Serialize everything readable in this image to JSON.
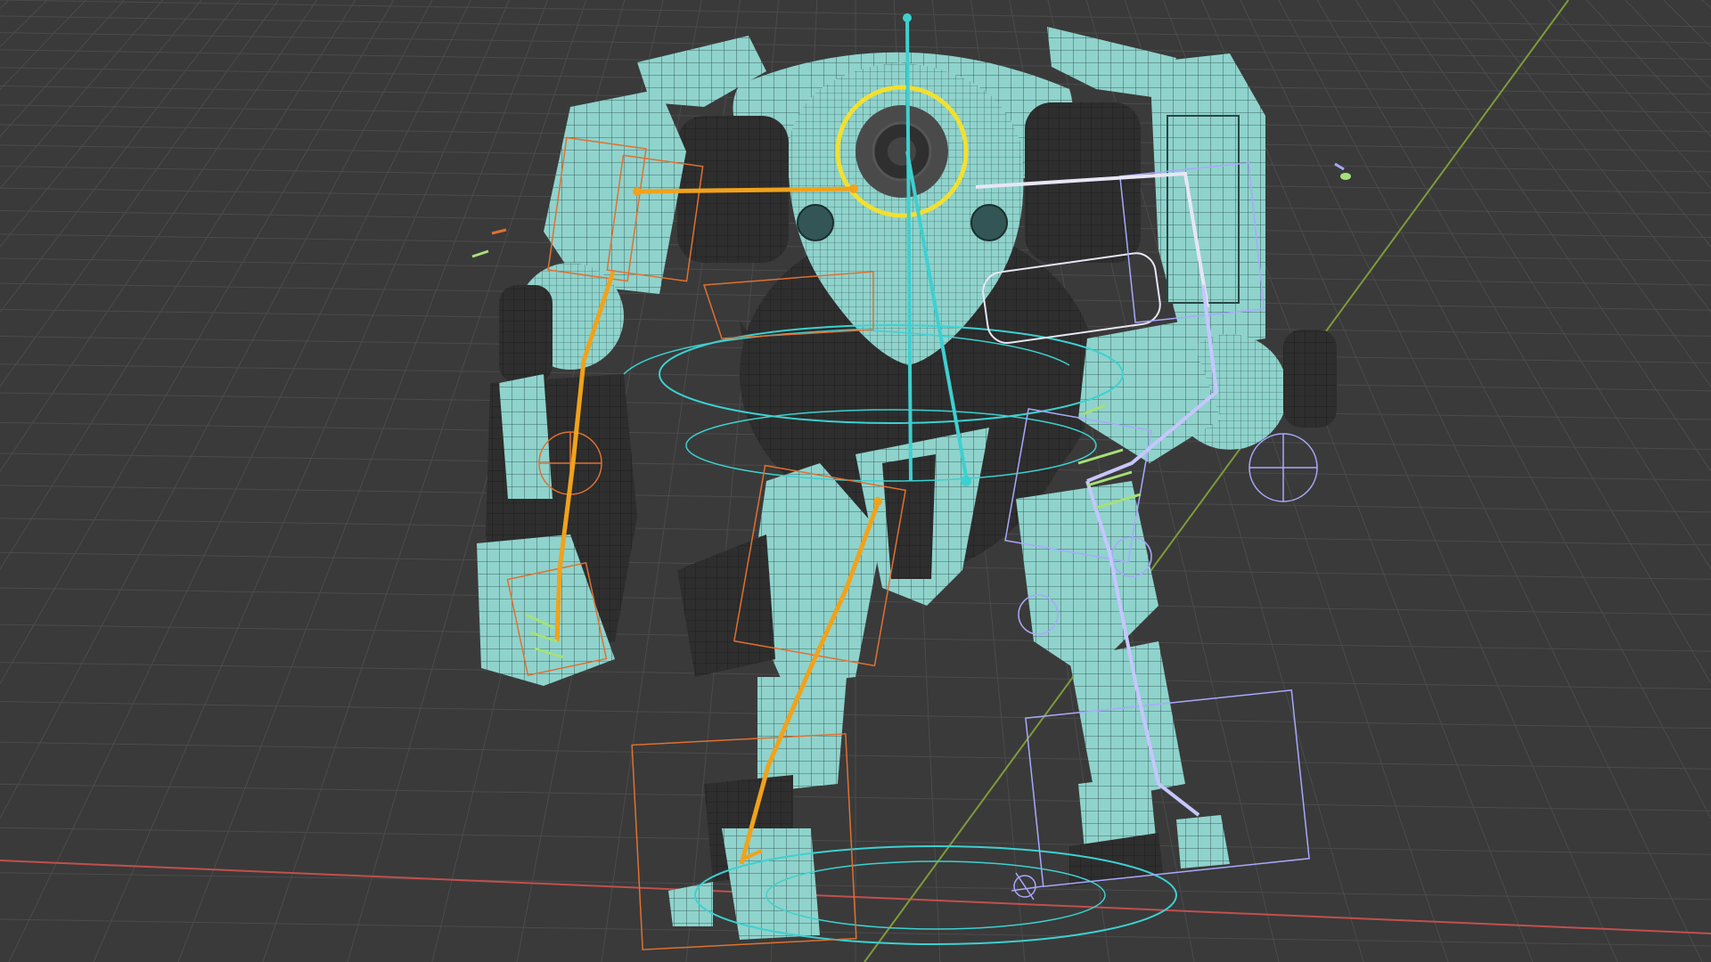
{
  "viewport": {
    "background": "#3a3a3a",
    "grid_color": "#4b4b4b",
    "x_axis_color": "#c0504d",
    "y_axis_color": "#7f9a3a"
  },
  "model": {
    "mesh_color": "#8fd3cc",
    "mesh_dark": "#2c2c2c",
    "wire_color": "#1f3a38"
  },
  "rig": {
    "active_bone_color": "#f0a21c",
    "left_chain_color": "#e07030",
    "right_chain_color": "#a9a8ff",
    "root_color": "#3ed0d0",
    "selection_ring_color": "#f2e030",
    "bone_tip_color": "#a6e07a"
  },
  "icons": [
    "bone-icon",
    "ik-control-icon",
    "root-circle-icon",
    "hand-control-icon",
    "foot-control-icon"
  ]
}
